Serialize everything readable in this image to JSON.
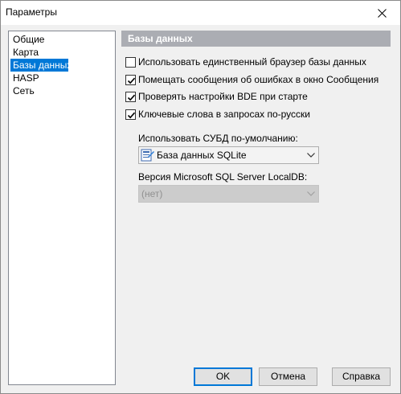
{
  "window": {
    "title": "Параметры"
  },
  "nav": {
    "items": [
      {
        "label": "Общие",
        "selected": false
      },
      {
        "label": "Карта",
        "selected": false
      },
      {
        "label": "Базы данных",
        "selected": true
      },
      {
        "label": "HASP",
        "selected": false
      },
      {
        "label": "Сеть",
        "selected": false
      }
    ]
  },
  "section": {
    "title": "Базы данных"
  },
  "options": [
    {
      "label": "Использовать единственный браузер базы данных",
      "checked": false
    },
    {
      "label": "Помещать сообщения об ошибках в окно Сообщения",
      "checked": true
    },
    {
      "label": "Проверять настройки BDE при старте",
      "checked": true
    },
    {
      "label": "Ключевые слова в запросах по-русски",
      "checked": true
    }
  ],
  "dbms": {
    "label": "Использовать СУБД по-умолчанию:",
    "value": "База данных SQLite",
    "icon": "database-icon"
  },
  "localdb": {
    "label": "Версия Microsoft SQL Server LocalDB:",
    "value": "(нет)",
    "disabled": true
  },
  "buttons": {
    "ok": "OK",
    "cancel": "Отмена",
    "help": "Справка"
  },
  "colors": {
    "selection": "#0078d7",
    "section_header_bg": "#abadb3",
    "window_bg": "#f0f0f0"
  }
}
